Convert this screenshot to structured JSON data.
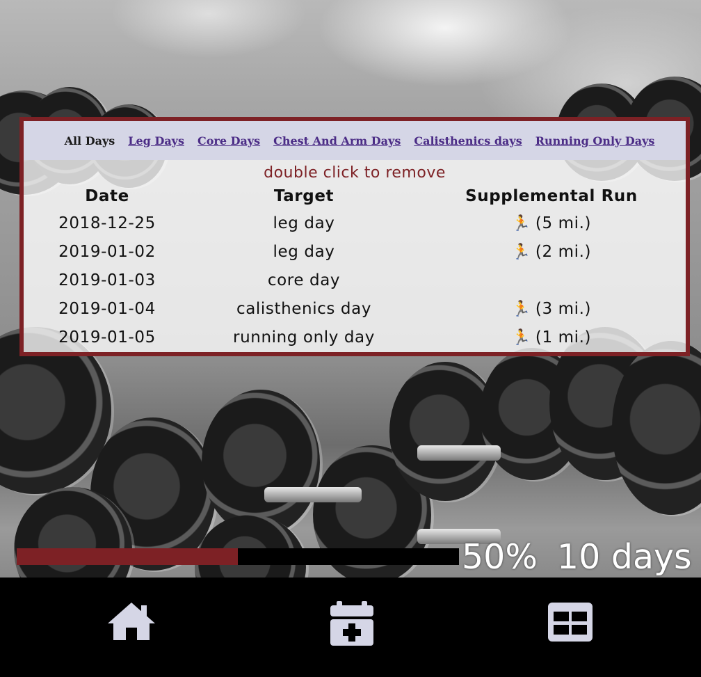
{
  "tabs": [
    {
      "label": "All Days",
      "active": true
    },
    {
      "label": "Leg Days",
      "active": false
    },
    {
      "label": "Core Days",
      "active": false
    },
    {
      "label": "Chest And Arm Days",
      "active": false
    },
    {
      "label": "Calisthenics days",
      "active": false
    },
    {
      "label": "Running Only Days",
      "active": false
    }
  ],
  "hint": "double click to remove",
  "table": {
    "headers": [
      "Date",
      "Target",
      "Supplemental Run"
    ],
    "rows": [
      {
        "date": "2018-12-25",
        "target": "leg day",
        "run": "(5 mi.)",
        "run_icon": "runner-icon"
      },
      {
        "date": "2019-01-02",
        "target": "leg day",
        "run": "(2 mi.)",
        "run_icon": "runner-icon"
      },
      {
        "date": "2019-01-03",
        "target": "core day",
        "run": "",
        "run_icon": ""
      },
      {
        "date": "2019-01-04",
        "target": "calisthenics day",
        "run": "(3 mi.)",
        "run_icon": "runner-icon"
      },
      {
        "date": "2019-01-05",
        "target": "running only day",
        "run": "(1 mi.)",
        "run_icon": "runner-icon"
      }
    ]
  },
  "progress": {
    "fraction": 0.5,
    "percent_label": "50%",
    "days_label": "10 days"
  },
  "nav": {
    "icons": [
      "home-icon",
      "calendar-add-icon",
      "grid-view-icon"
    ]
  },
  "colors": {
    "accent": "#7d2125",
    "tab_bar": "#d5d6e6",
    "link": "#4b2c86",
    "nav_icon": "#d5d6e6",
    "nav_bg": "#000000"
  }
}
